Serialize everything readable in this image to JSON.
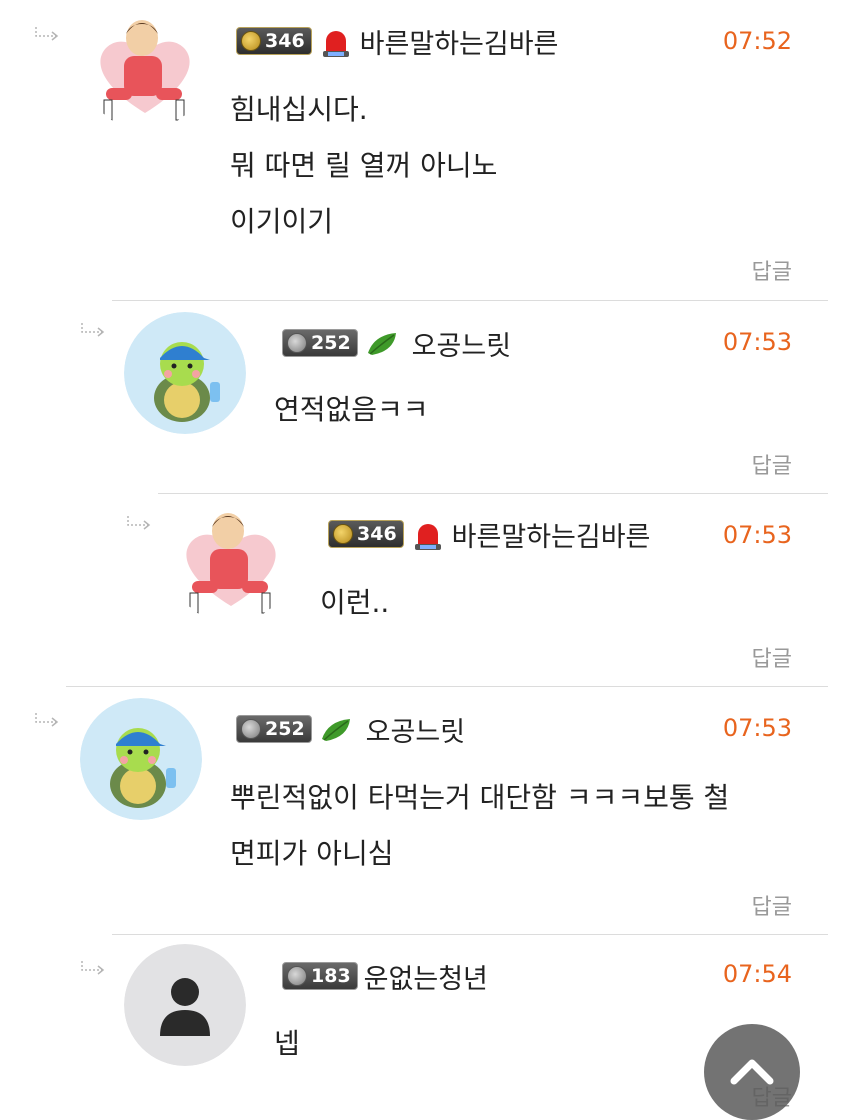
{
  "reply_label": "답글",
  "comments": [
    {
      "level": "346",
      "nickname": "바른말하는김바른",
      "time": "07:52",
      "avatar": "pink-character-avatar",
      "emblem": "red-siren-emblem",
      "lines": [
        "힘내십시다.",
        "뭐 따면 릴 열꺼 아니노",
        "이기이기"
      ]
    },
    {
      "level": "252",
      "nickname": "오공느릿",
      "time": "07:53",
      "avatar": "turtle-mascot-avatar",
      "emblem": "green-leaf-emblem",
      "lines": [
        "연적없음ㅋㅋ"
      ]
    },
    {
      "level": "346",
      "nickname": "바른말하는김바른",
      "time": "07:53",
      "avatar": "pink-character-avatar",
      "emblem": "red-siren-emblem",
      "lines": [
        "이런.."
      ]
    },
    {
      "level": "252",
      "nickname": "오공느릿",
      "time": "07:53",
      "avatar": "turtle-mascot-avatar",
      "emblem": "green-leaf-emblem",
      "lines": [
        "뿌린적없이 타먹는거 대단함 ㅋㅋㅋ보통 철",
        "면피가 아니심"
      ]
    },
    {
      "level": "183",
      "nickname": "운없는청년",
      "time": "07:54",
      "avatar": "default-user-avatar",
      "emblem": "",
      "lines": [
        "넵"
      ]
    }
  ],
  "colors": {
    "time": "#e8641e",
    "reply": "#999999",
    "divider": "#dcdcdc"
  }
}
